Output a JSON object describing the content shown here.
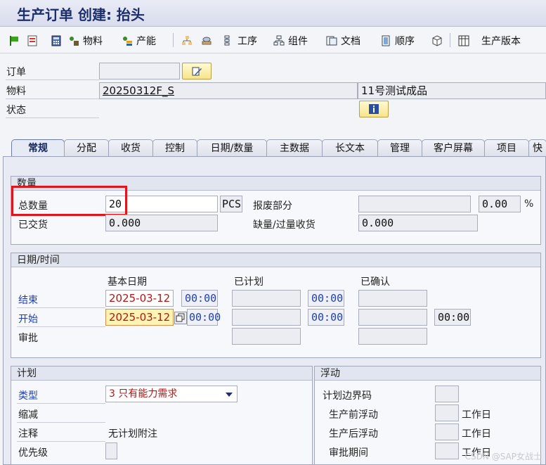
{
  "header": {
    "title": "生产订单 创建: 抬头"
  },
  "toolbar": {
    "material": "物料",
    "capacity": "产能",
    "operation": "工序",
    "component": "组件",
    "document": "文档",
    "sequence": "顺序",
    "production_version": "生产版本"
  },
  "header_fields": {
    "order_label": "订单",
    "order_value": "",
    "material_label": "物料",
    "material_value": "20250312F_S",
    "material_desc": "11号测试成品",
    "status_label": "状态"
  },
  "tabs": [
    "常规",
    "分配",
    "收货",
    "控制",
    "日期/数量",
    "主数据",
    "长文本",
    "管理",
    "客户屏幕",
    "项目",
    "快"
  ],
  "quantity": {
    "group_title": "数量",
    "total_qty_label": "总数量",
    "total_qty_value": "20",
    "unit": "PCS",
    "scrap_label": "报废部分",
    "scrap_value": "",
    "scrap_percent": "0.00",
    "percent_sign": "%",
    "delivered_label": "已交货",
    "delivered_value": "0.000",
    "short_over_label": "缺量/过量收货",
    "short_over_value": "0.000"
  },
  "dates": {
    "group_title": "日期/时间",
    "col_basic": "基本日期",
    "col_scheduled": "已计划",
    "col_confirmed": "已确认",
    "end_label": "结束",
    "end_date": "2025-03-12",
    "end_time": "00:00",
    "end_sched_time": "00:00",
    "start_label": "开始",
    "start_date": "2025-03-12",
    "start_time": "00:00",
    "start_sched_time": "00:00",
    "start_conf_time": "00:00",
    "release_label": "审批"
  },
  "plan": {
    "group_title": "计划",
    "type_label": "类型",
    "type_value": "3 只有能力需求",
    "reduction_label": "缩减",
    "note_label": "注释",
    "note_value": "无计划附注",
    "priority_label": "优先级"
  },
  "float": {
    "group_title": "浮动",
    "sched_margin_label": "计划边界码",
    "float_before_label": "生产前浮动",
    "float_after_label": "生产后浮动",
    "release_period_label": "审批期间",
    "workday_unit": "工作日"
  },
  "watermark": "CSDN @SAP女战士"
}
